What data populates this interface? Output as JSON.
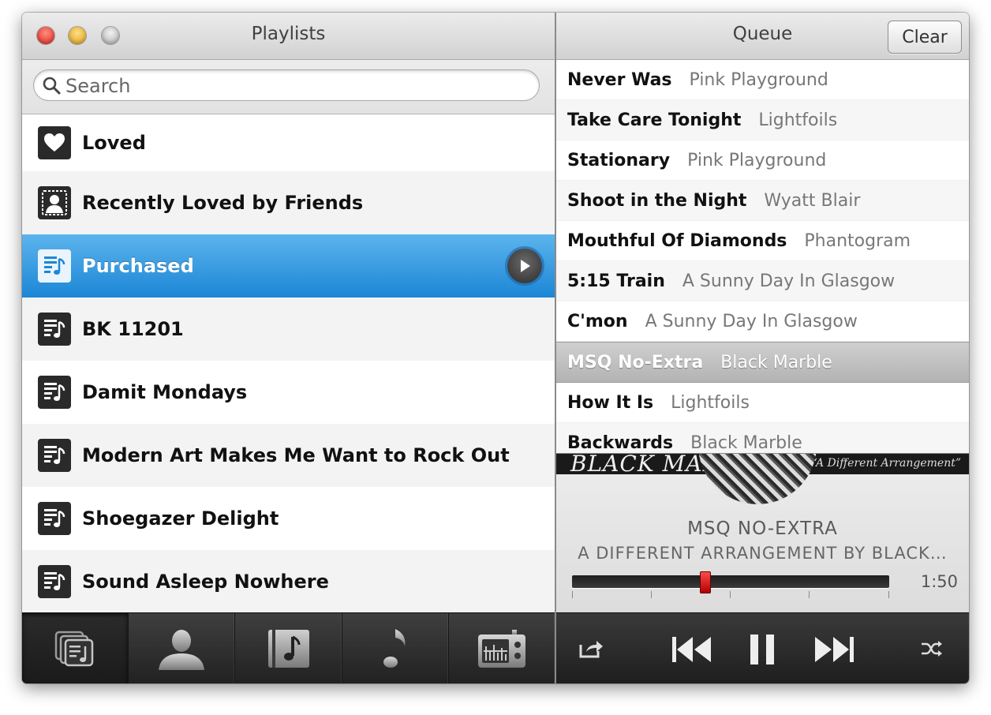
{
  "left_pane": {
    "title": "Playlists",
    "search": {
      "placeholder": "Search",
      "value": ""
    },
    "playlists": [
      {
        "label": "Loved",
        "icon": "heart-icon"
      },
      {
        "label": "Recently Loved by Friends",
        "icon": "friend-icon"
      },
      {
        "label": "Purchased",
        "icon": "playlist-icon",
        "selected": true
      },
      {
        "label": "BK 11201",
        "icon": "playlist-icon"
      },
      {
        "label": "Damit Mondays",
        "icon": "playlist-icon"
      },
      {
        "label": "Modern Art Makes Me Want to Rock Out",
        "icon": "playlist-icon"
      },
      {
        "label": "Shoegazer Delight",
        "icon": "playlist-icon"
      },
      {
        "label": "Sound Asleep Nowhere",
        "icon": "playlist-icon"
      }
    ],
    "toolbar": [
      "playlists-icon",
      "people-icon",
      "albums-icon",
      "music-note-icon",
      "radio-icon"
    ]
  },
  "right_pane": {
    "title": "Queue",
    "clear_label": "Clear",
    "queue": [
      {
        "song": "Never Was",
        "artist": "Pink Playground"
      },
      {
        "song": "Take Care Tonight",
        "artist": "Lightfoils"
      },
      {
        "song": "Stationary",
        "artist": "Pink Playground"
      },
      {
        "song": "Shoot in the Night",
        "artist": "Wyatt Blair"
      },
      {
        "song": "Mouthful Of Diamonds",
        "artist": "Phantogram"
      },
      {
        "song": "5:15 Train",
        "artist": "A Sunny Day In Glasgow"
      },
      {
        "song": "C'mon",
        "artist": "A Sunny Day In Glasgow"
      },
      {
        "song": "MSQ No-Extra",
        "artist": "Black Marble",
        "current": true
      },
      {
        "song": "How It Is",
        "artist": "Lightfoils"
      },
      {
        "song": "Backwards",
        "artist": "Black Marble"
      }
    ],
    "now_playing": {
      "art_title": "BLACK MARBLE",
      "art_subtitle": "“A Different Arrangement”",
      "track": "MSQ NO-EXTRA",
      "album": "A DIFFERENT ARRANGEMENT BY BLACK…",
      "time": "1:50",
      "progress": 0.42
    },
    "toolbar": [
      "share-icon",
      "previous-icon",
      "pause-icon",
      "next-icon",
      "shuffle-icon"
    ]
  },
  "colors": {
    "selection_blue": "#1c86d6",
    "progress_thumb": "#d40000"
  }
}
